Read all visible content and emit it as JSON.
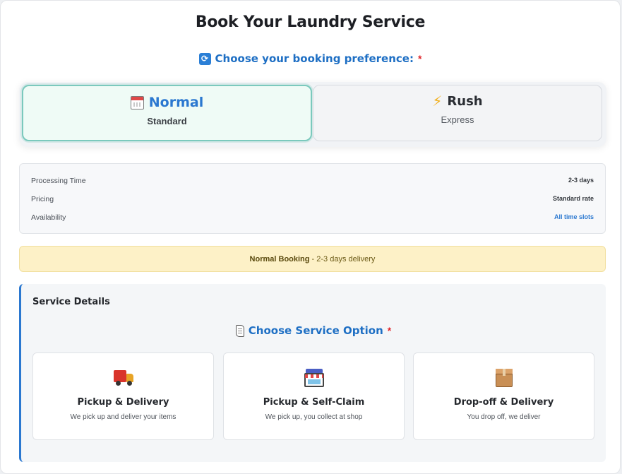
{
  "header": {
    "title": "Book Your Laundry Service"
  },
  "booking": {
    "label": "Choose your booking preference:",
    "required_mark": "*",
    "icon": "sync-icon",
    "options": [
      {
        "title": "Normal",
        "subtitle": "Standard",
        "icon": "calendar-icon",
        "selected": true
      },
      {
        "title": "Rush",
        "subtitle": "Express",
        "icon": "lightning-icon",
        "selected": false
      }
    ]
  },
  "info": {
    "rows": [
      {
        "label": "Processing Time",
        "value": "2-3 days"
      },
      {
        "label": "Pricing",
        "value": "Standard rate"
      },
      {
        "label": "Availability",
        "value": "All time slots"
      }
    ]
  },
  "banner": {
    "strong": "Normal Booking",
    "text": " - 2-3 days delivery"
  },
  "service": {
    "title": "Service Details",
    "option_label": "Choose Service Option",
    "required_mark": "*",
    "icon": "scroll-icon",
    "tiles": [
      {
        "title": "Pickup & Delivery",
        "desc": "We pick up and deliver your items",
        "icon": "truck-icon"
      },
      {
        "title": "Pickup & Self-Claim",
        "desc": "We pick up, you collect at shop",
        "icon": "store-icon"
      },
      {
        "title": "Drop-off & Delivery",
        "desc": "You drop off, we deliver",
        "icon": "package-icon"
      }
    ]
  },
  "colors": {
    "accent_blue": "#2b78d0",
    "required_red": "#e0262b",
    "selected_bg": "#effbf6",
    "banner_bg": "#fdf1c7"
  }
}
